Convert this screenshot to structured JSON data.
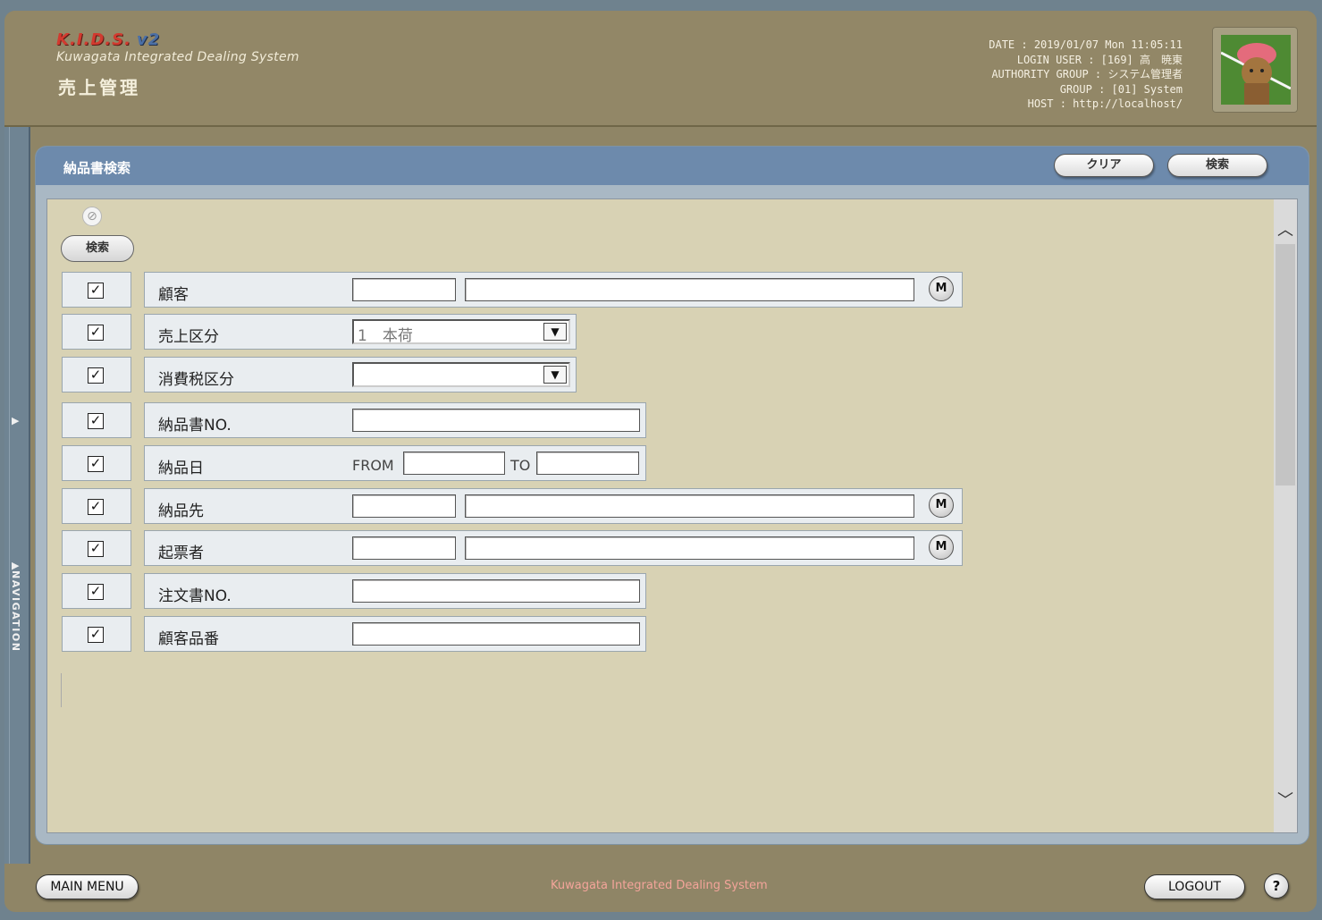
{
  "app": {
    "logo": "K.I.D.S.",
    "logo_version": "v2",
    "subtitle": "Kuwagata Integrated Dealing System",
    "module": "売上管理"
  },
  "info": {
    "date": "DATE : 2019/01/07 Mon 11:05:11",
    "login_user": "LOGIN USER : [169] 高　暁東",
    "authority_group": "AUTHORITY GROUP : システム管理者",
    "group": "GROUP : [01] System",
    "host": "HOST : http://localhost/"
  },
  "nav": {
    "label": "NAVIGATION"
  },
  "panel": {
    "title": "納品書検索",
    "clear_label": "クリア",
    "search_label": "検索",
    "small_search_label": "検索",
    "clear_icon": "⊘"
  },
  "fields": {
    "customer": {
      "label": "顧客",
      "checked": "✓"
    },
    "sales_type": {
      "label": "売上区分",
      "value": "1　本荷",
      "checked": "✓"
    },
    "tax_type": {
      "label": "消費税区分",
      "value": "",
      "checked": "✓"
    },
    "delivery_no": {
      "label": "納品書NO.",
      "checked": "✓"
    },
    "delivery_date": {
      "label": "納品日",
      "from": "FROM",
      "to": "TO",
      "checked": "✓"
    },
    "destination": {
      "label": "納品先",
      "checked": "✓"
    },
    "issuer": {
      "label": "起票者",
      "checked": "✓"
    },
    "order_no": {
      "label": "注文書NO.",
      "checked": "✓"
    },
    "customer_part": {
      "label": "顧客品番",
      "checked": "✓"
    }
  },
  "m_label": "M",
  "footer": {
    "main_menu": "MAIN MENU",
    "center_text": "Kuwagata Integrated Dealing System",
    "logout": "LOGOUT",
    "help": "?"
  }
}
